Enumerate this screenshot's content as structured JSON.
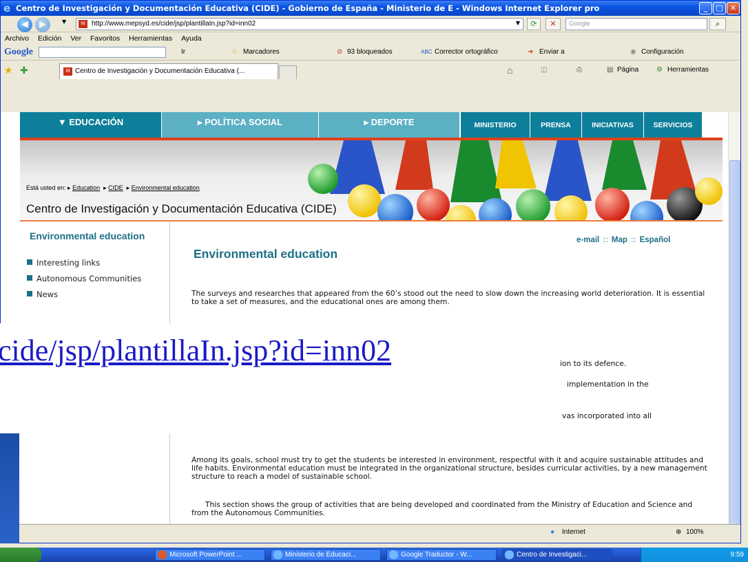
{
  "window": {
    "title": "Centro de Investigación y Documentación Educativa (CIDE) - Gobierno de España - Ministerio de E - Windows Internet Explorer pro"
  },
  "address": {
    "url": "http://www.mepsyd.es/cide/jsp/plantillaIn.jsp?id=inn02",
    "search_placeholder": "Google"
  },
  "menu": [
    "Archivo",
    "Edición",
    "Ver",
    "Favoritos",
    "Herramientas",
    "Ayuda"
  ],
  "google_toolbar": {
    "logo": "Google",
    "go": "Ir",
    "bookmarks": "Marcadores",
    "blocked": "93 bloqueados",
    "spell": "Corrector ortográfico",
    "send": "Enviar a",
    "settings": "Configuración"
  },
  "tabs": {
    "active": "Centro de Investigación y Documentación Educativa (...",
    "page_menu": "Página",
    "tools_menu": "Herramientas"
  },
  "site": {
    "nav_main": [
      "EDUCACIÓN",
      "POLÍTICA SOCIAL",
      "DEPORTE"
    ],
    "nav_secondary": [
      "MINISTERIO",
      "PRENSA",
      "INICIATIVAS",
      "SERVICIOS"
    ],
    "breadcrumb_prefix": "Está usted en:",
    "breadcrumb": [
      "Education",
      "CIDE",
      "Environmental education"
    ],
    "site_title": "Centro de Investigación y Documentación Educativa (CIDE)",
    "sidebar_title": "Environmental education",
    "sidebar_items": [
      "Interesting links",
      "Autonomous Communities",
      "News"
    ],
    "top_links": [
      "e-mail",
      "Map",
      "Español"
    ],
    "page_title": "Environmental education",
    "p1": "The surveys and researches that appeared from the 60’s stood out the need to slow down the increasing world deterioration. It is essential to take a set of measures, and the educational ones are among them.",
    "fragment1": "ion to its defence.",
    "fragment2": "implementation in the",
    "fragment3": "vas incorporated into all",
    "p2": "Among its goals, school must try to get the students be interested in environment, respectful with it and acquire sustainable attitudes and life habits. Environmental education must be integrated in the organizational structure, besides curricular activities, by a new management structure to reach a model of sustainable school.",
    "p3": "This section shows the group of activities that are being developed and coordinated from the Ministry of Education and Science and from the Autonomous Communities."
  },
  "overlay_link": "cide/jsp/plantillaIn.jsp?id=inn02",
  "status": {
    "zone": "Internet",
    "zoom": "100%"
  },
  "taskbar": {
    "items": [
      "Microsoft PowerPoint ...",
      "Ministerio de Educaci...",
      "Google Traductor - W...",
      "Centro de Investigaci..."
    ],
    "clock": "9:59"
  },
  "colors": {
    "teal": "#1d6f86",
    "nav_bg": "#0e7f9a",
    "accent_red": "#e0401a"
  }
}
